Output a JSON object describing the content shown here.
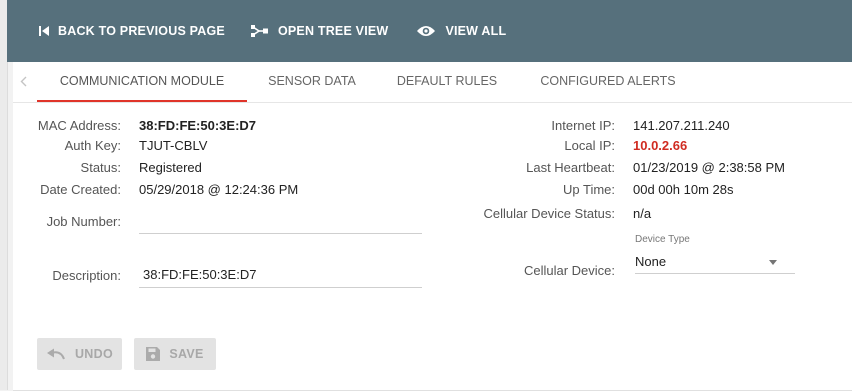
{
  "toolbar": {
    "back_label": "BACK TO PREVIOUS PAGE",
    "tree_label": "OPEN TREE VIEW",
    "viewall_label": "VIEW ALL",
    "back_icon": "skip-previous-icon",
    "tree_icon": "tree-icon",
    "viewall_icon": "eye-icon"
  },
  "tabs": [
    {
      "label": "COMMUNICATION MODULE",
      "active": true
    },
    {
      "label": "SENSOR DATA",
      "active": false
    },
    {
      "label": "DEFAULT RULES",
      "active": false
    },
    {
      "label": "CONFIGURED ALERTS",
      "active": false
    }
  ],
  "details_left": {
    "mac_label": "MAC Address:",
    "mac_value": "38:FD:FE:50:3E:D7",
    "auth_label": "Auth Key:",
    "auth_value": "TJUT-CBLV",
    "status_label": "Status:",
    "status_value": "Registered",
    "created_label": "Date Created:",
    "created_value": "05/29/2018 @ 12:24:36 PM",
    "job_label": "Job Number:",
    "job_value": "",
    "desc_label": "Description:",
    "desc_value": "38:FD:FE:50:3E:D7"
  },
  "details_right": {
    "internet_ip_label": "Internet IP:",
    "internet_ip_value": "141.207.211.240",
    "local_ip_label": "Local IP:",
    "local_ip_value": "10.0.2.66",
    "heartbeat_label": "Last Heartbeat:",
    "heartbeat_value": "01/23/2019 @ 2:38:58 PM",
    "uptime_label": "Up Time:",
    "uptime_value": "00d 00h 10m 28s",
    "cell_status_label": "Cellular Device Status:",
    "cell_status_value": "n/a",
    "cell_device_label": "Cellular Device:",
    "device_type_label": "Device Type",
    "device_type_value": "None"
  },
  "actions": {
    "undo_label": "UNDO",
    "save_label": "SAVE"
  },
  "colors": {
    "toolbar_bg": "#56707c",
    "accent_red": "#e0342a",
    "local_ip_red": "#d02c22"
  }
}
